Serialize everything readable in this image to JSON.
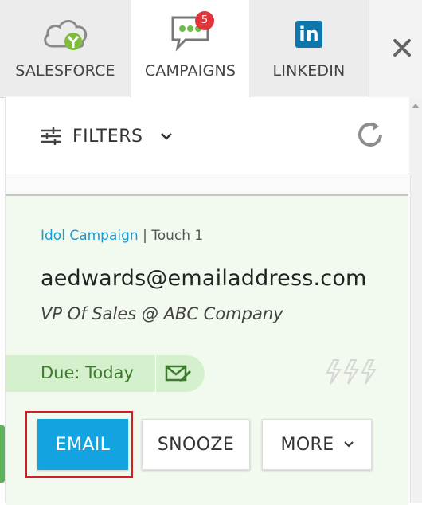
{
  "tabs": [
    {
      "label": "SALESFORCE",
      "icon": "salesforce-cloud-icon"
    },
    {
      "label": "CAMPAIGNS",
      "icon": "chat-bubble-icon",
      "badge": "5",
      "active": true
    },
    {
      "label": "LINKEDIN",
      "icon": "linkedin-icon",
      "icon_text": "in"
    }
  ],
  "close_icon": "close-icon",
  "toolbar": {
    "filters_label": "FILTERS",
    "filter_icon": "sliders-icon",
    "dropdown_icon": "chevron-down-icon",
    "refresh_icon": "refresh-icon"
  },
  "card": {
    "campaign_name": "Idol Campaign",
    "touch_label": "| Touch 1",
    "email": "aedwards@emailaddress.com",
    "title": "VP Of Sales @ ABC Company",
    "due_label": "Due: Today",
    "due_icon": "edit-mail-icon",
    "bolt_icon": "lightning-icon"
  },
  "actions": {
    "email_label": "EMAIL",
    "snooze_label": "SNOOZE",
    "more_label": "MORE"
  },
  "colors": {
    "accent": "#13a3e0",
    "badge": "#e0353b",
    "due_bg": "#d5f0cc",
    "card_bg": "#f2f9ef",
    "highlight": "#d21f26"
  }
}
